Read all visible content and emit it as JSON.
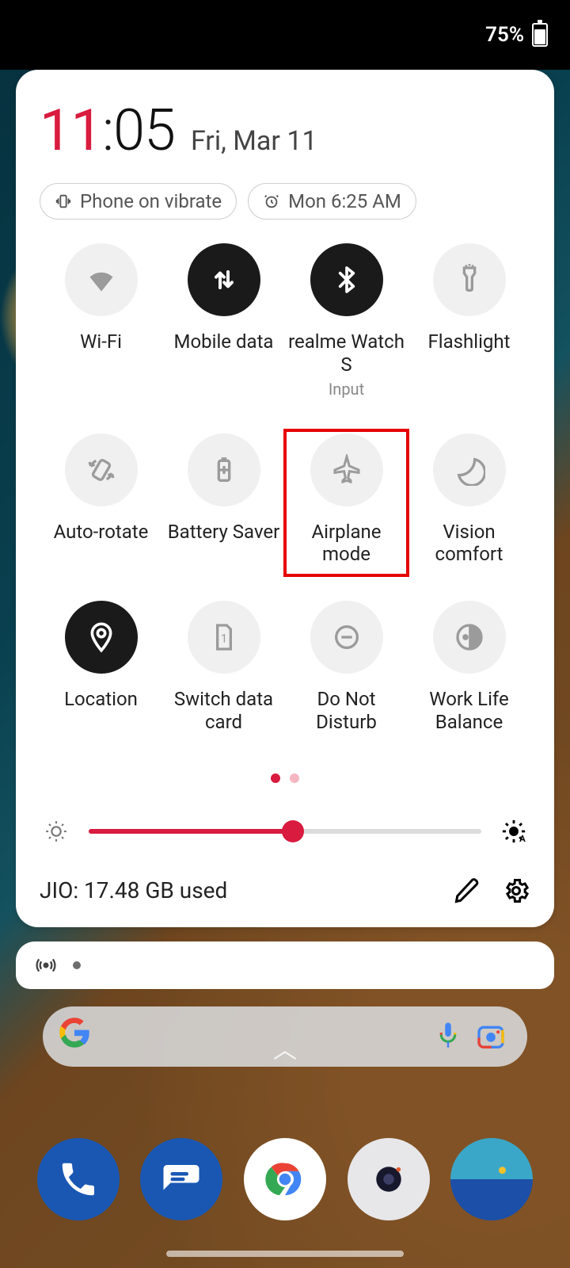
{
  "status": {
    "battery_pct": "75%"
  },
  "clock": {
    "hours": "11",
    "sep": ":",
    "minutes": "05"
  },
  "date": "Fri, Mar 11",
  "chips": {
    "vibrate": "Phone on vibrate",
    "alarm": "Mon 6:25 AM"
  },
  "tiles": [
    {
      "id": "wifi",
      "label": "Wi-Fi",
      "sub": "",
      "on": false
    },
    {
      "id": "mobile-data",
      "label": "Mobile data",
      "sub": "",
      "on": true
    },
    {
      "id": "realme-watch",
      "label": "realme Watch S",
      "sub": "Input",
      "on": true
    },
    {
      "id": "flashlight",
      "label": "Flashlight",
      "sub": "",
      "on": false
    },
    {
      "id": "auto-rotate",
      "label": "Auto-rotate",
      "sub": "",
      "on": false
    },
    {
      "id": "battery-saver",
      "label": "Battery Saver",
      "sub": "",
      "on": false
    },
    {
      "id": "airplane-mode",
      "label": "Airplane mode",
      "sub": "",
      "on": false
    },
    {
      "id": "vision-comfort",
      "label": "Vision comfort",
      "sub": "",
      "on": false
    },
    {
      "id": "location",
      "label": "Location",
      "sub": "",
      "on": true
    },
    {
      "id": "switch-sim",
      "label": "Switch data card",
      "sub": "",
      "on": false
    },
    {
      "id": "dnd",
      "label": "Do Not Disturb",
      "sub": "",
      "on": false
    },
    {
      "id": "work-life",
      "label": "Work Life Balance",
      "sub": "",
      "on": false
    }
  ],
  "brightness_pct": 52,
  "usage": "JIO: 17.48 GB used",
  "highlight_tile_id": "airplane-mode",
  "colors": {
    "accent": "#d81b3e",
    "tile_on": "#1a1a1a",
    "tile_off_bg": "#f0f0f0",
    "highlight": "#e60000"
  }
}
